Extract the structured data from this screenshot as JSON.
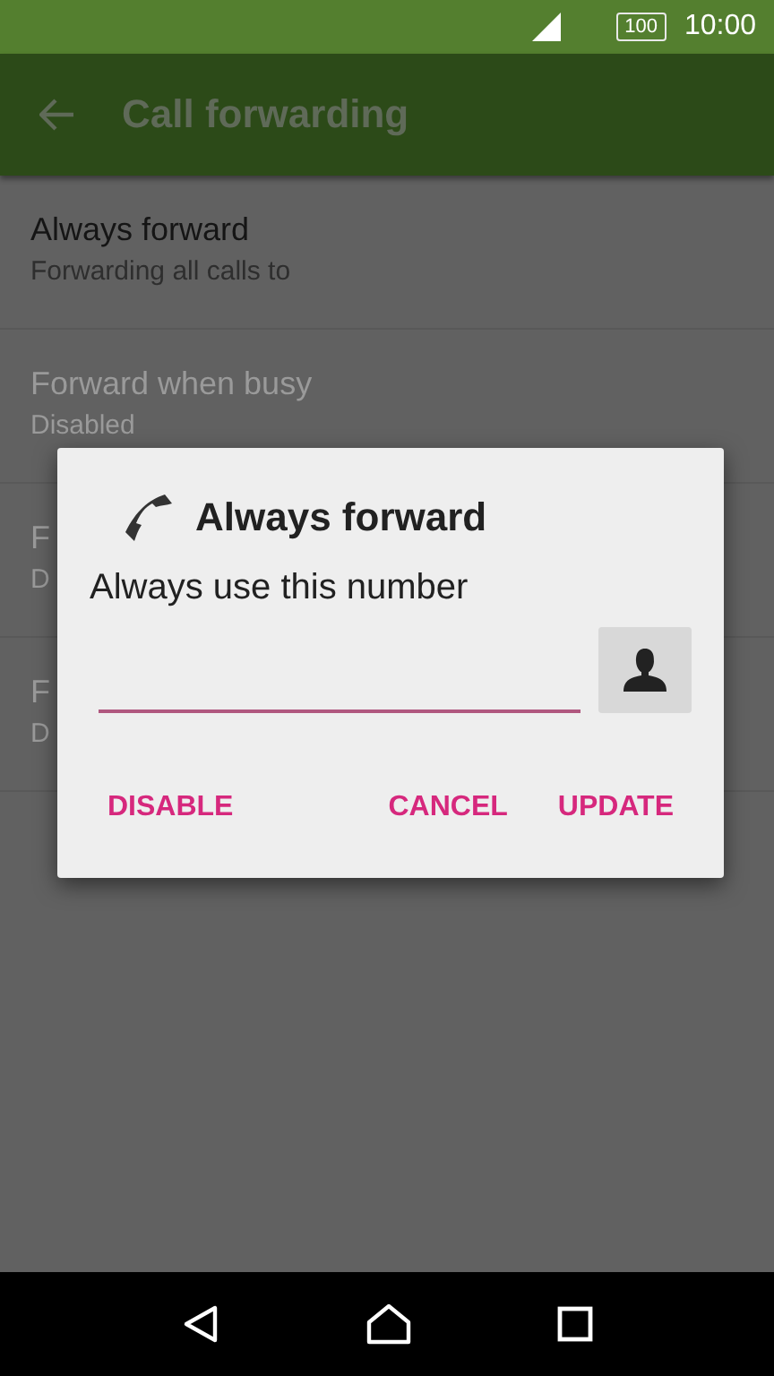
{
  "status_bar": {
    "battery": "100",
    "time": "10:00"
  },
  "app_bar": {
    "title": "Call forwarding"
  },
  "settings": [
    {
      "title": "Always forward",
      "summary": "Forwarding all calls to",
      "disabled": false
    },
    {
      "title": "Forward when busy",
      "summary": "Disabled",
      "disabled": true
    },
    {
      "title": "F",
      "summary": "D",
      "disabled": true
    },
    {
      "title": "F",
      "summary": "D",
      "disabled": true
    }
  ],
  "dialog": {
    "title": "Always forward",
    "message": "Always use this number",
    "buttons": [
      {
        "label": "DISABLE",
        "kind": "left"
      },
      {
        "label": "CANCEL",
        "kind": "right"
      },
      {
        "label": "UPDATE",
        "kind": "right"
      }
    ]
  }
}
